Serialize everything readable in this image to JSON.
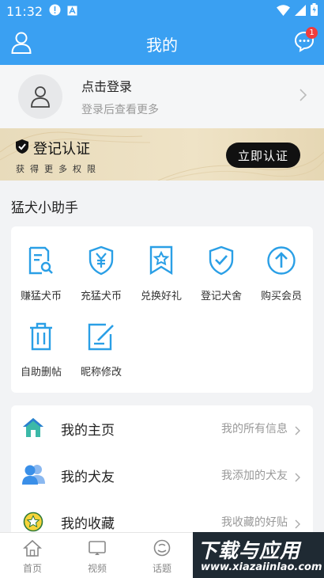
{
  "status_bar": {
    "time": "11:32"
  },
  "header": {
    "title": "我的",
    "notification_count": "1"
  },
  "login": {
    "title": "点击登录",
    "subtitle": "登录后查看更多"
  },
  "verify": {
    "title": "登记认证",
    "subtitle": "获得更多权限",
    "button": "立即认证"
  },
  "helper": {
    "title": "猛犬小助手",
    "items": [
      {
        "label": "赚猛犬币",
        "icon": "document-search-icon"
      },
      {
        "label": "充猛犬币",
        "icon": "yuan-shield-icon"
      },
      {
        "label": "兑换好礼",
        "icon": "star-bookmark-icon"
      },
      {
        "label": "登记犬舍",
        "icon": "check-shield-icon"
      },
      {
        "label": "购买会员",
        "icon": "arrow-up-circle-icon"
      },
      {
        "label": "自助删帖",
        "icon": "trash-icon"
      },
      {
        "label": "昵称修改",
        "icon": "edit-icon"
      }
    ]
  },
  "menu": [
    {
      "title": "我的主页",
      "desc": "我的所有信息",
      "icon": "home-icon"
    },
    {
      "title": "我的犬友",
      "desc": "我添加的犬友",
      "icon": "friends-icon"
    },
    {
      "title": "我的收藏",
      "desc": "我收藏的好贴",
      "icon": "favorite-icon"
    }
  ],
  "tabs": [
    {
      "label": "首页",
      "icon": "home-tab-icon"
    },
    {
      "label": "视频",
      "icon": "video-tab-icon"
    },
    {
      "label": "话题",
      "icon": "topic-tab-icon"
    }
  ],
  "watermark": {
    "main": "下载与应用",
    "sub": "www.xiazaiinlao.com"
  },
  "colors": {
    "primary": "#3aa0f2",
    "gold": "#e8dbbb",
    "badge": "#f03c3c"
  }
}
